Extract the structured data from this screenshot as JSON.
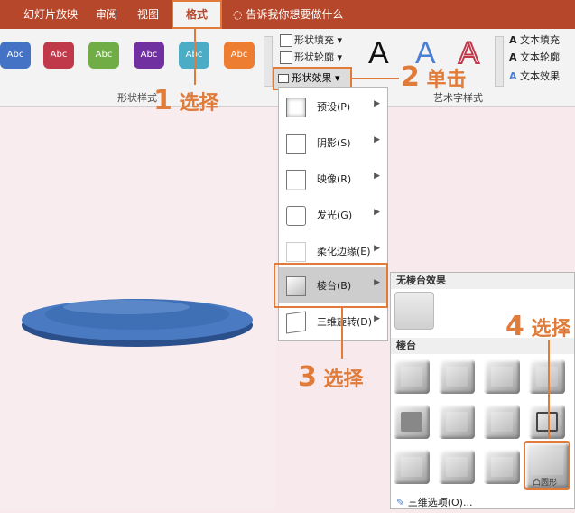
{
  "ribbon": {
    "tabs": [
      {
        "label": "幻灯片放映"
      },
      {
        "label": "审阅"
      },
      {
        "label": "视图"
      },
      {
        "label": "格式"
      }
    ],
    "tell_me": "告诉我你想要做什么",
    "shape_styles_label": "形状样式",
    "wordart_styles_label": "艺术字样式",
    "style_swatches": [
      {
        "text": "Abc",
        "color": "#4472c4"
      },
      {
        "text": "Abc",
        "color": "#c0394b"
      },
      {
        "text": "Abc",
        "color": "#70ad47"
      },
      {
        "text": "Abc",
        "color": "#7030a0"
      },
      {
        "text": "Abc",
        "color": "#4bacc6"
      },
      {
        "text": "Abc",
        "color": "#ed7d31"
      }
    ],
    "shape_fill": "形状填充",
    "shape_outline": "形状轮廓",
    "shape_effects": "形状效果",
    "text_fill": "文本填充",
    "text_outline": "文本轮廓",
    "text_effects": "文本效果",
    "wordart_letters": [
      "A",
      "A",
      "A"
    ]
  },
  "effects_menu": {
    "items": [
      {
        "label": "预设(P)"
      },
      {
        "label": "阴影(S)"
      },
      {
        "label": "映像(R)"
      },
      {
        "label": "发光(G)"
      },
      {
        "label": "柔化边缘(E)"
      },
      {
        "label": "棱台(B)"
      },
      {
        "label": "三维旋转(D)"
      }
    ]
  },
  "bevel_submenu": {
    "no_bevel_header": "无棱台效果",
    "bevel_header": "棱台",
    "selected_tooltip": "凸圆形",
    "options_label": "三维选项(O)..."
  },
  "callouts": {
    "step1": {
      "num": "1",
      "text": "选择"
    },
    "step2": {
      "num": "2",
      "text": "单击"
    },
    "step3": {
      "num": "3",
      "text": "选择"
    },
    "step4": {
      "num": "4",
      "text": "选择"
    }
  },
  "colors": {
    "accent": "#e07b39",
    "ribbon": "#b7472a",
    "shape": "#3f6fb5"
  }
}
